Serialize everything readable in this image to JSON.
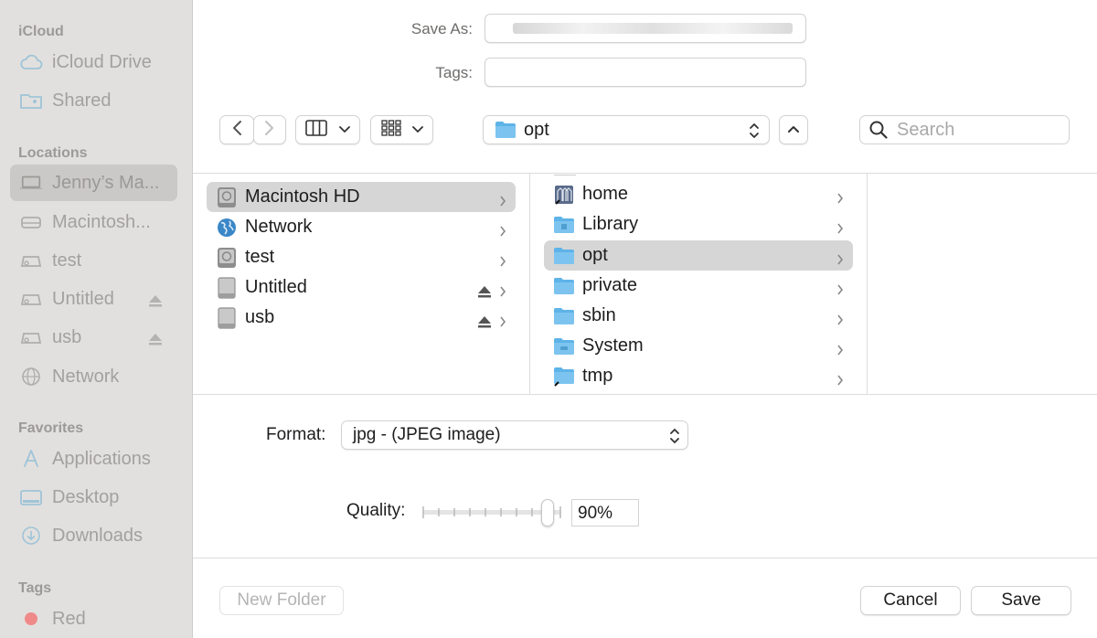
{
  "sidebar": {
    "sections": {
      "icloud": "iCloud",
      "locations": "Locations",
      "favorites": "Favorites",
      "tags": "Tags"
    },
    "icloud_items": [
      "iCloud Drive",
      "Shared"
    ],
    "location_items": [
      "Jenny’s Ma...",
      "Macintosh...",
      "test",
      "Untitled",
      "usb",
      "Network"
    ],
    "favorite_items": [
      "Applications",
      "Desktop",
      "Downloads"
    ],
    "tag_items": [
      "Red"
    ],
    "tag_color": "#f08a8a"
  },
  "header": {
    "save_as_label": "Save As:",
    "save_as_value": "",
    "tags_label": "Tags:",
    "tags_value": ""
  },
  "toolbar": {
    "back_icon": "chevron-left-icon",
    "forward_icon": "chevron-right-icon",
    "view_icon": "column-view-icon",
    "group_icon": "grid-icon",
    "path_current": "opt",
    "search_placeholder": "Search"
  },
  "browser": {
    "column1": [
      "Macintosh HD",
      "Network",
      "test",
      "Untitled",
      "usb"
    ],
    "column2": [
      "home",
      "Library",
      "opt",
      "private",
      "sbin",
      "System",
      "tmp"
    ]
  },
  "options": {
    "format_label": "Format:",
    "format_value": "jpg - (JPEG image)",
    "quality_label": "Quality:",
    "quality_value": "90%",
    "quality_fraction": 0.9
  },
  "footer": {
    "new_folder": "New Folder",
    "cancel": "Cancel",
    "save": "Save"
  },
  "colors": {
    "sidebar_bg": "#e2e0de",
    "folder_blue": "#5eb3e8",
    "accent": "#4a90d9"
  }
}
